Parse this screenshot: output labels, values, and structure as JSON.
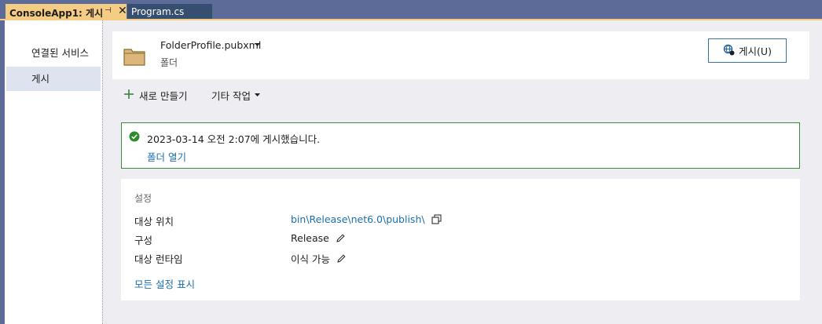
{
  "tabs": [
    {
      "label": "ConsoleApp1: 게시",
      "active": true
    },
    {
      "label": "Program.cs",
      "active": false
    }
  ],
  "tab_icons": {
    "pin": "pin-icon",
    "close": "close-icon"
  },
  "nav": {
    "items": [
      {
        "label": "연결된 서비스",
        "selected": false
      },
      {
        "label": "게시",
        "selected": true
      }
    ]
  },
  "profile": {
    "name": "FolderProfile.pubxml",
    "type": "폴더",
    "dropdown_icon": "caret-down-icon",
    "icon": "folder-icon"
  },
  "publish_button": {
    "label": "게시(U)",
    "icon": "globe-publish-icon"
  },
  "toolbar": {
    "new_label": "새로 만들기",
    "other_label": "기타 작업",
    "new_icon": "plus-icon"
  },
  "status": {
    "message": "2023-03-14 오전 2:07에 게시했습니다.",
    "link": "폴더 열기",
    "icon": "check-circle-icon"
  },
  "settings": {
    "title": "설정",
    "rows": [
      {
        "label": "대상 위치",
        "value": "bin\\Release\\net6.0\\publish\\"
      },
      {
        "label": "구성",
        "value": "Release"
      },
      {
        "label": "대상 런타임",
        "value": "이식 가능"
      }
    ],
    "show_all": "모든 설정 표시"
  },
  "colors": {
    "tab_active": "#f5cc84",
    "tab_strip": "#5d6b99",
    "link": "#1a6fb0",
    "success_border": "#3c8a3c",
    "nav_selected": "#dde4ef"
  }
}
